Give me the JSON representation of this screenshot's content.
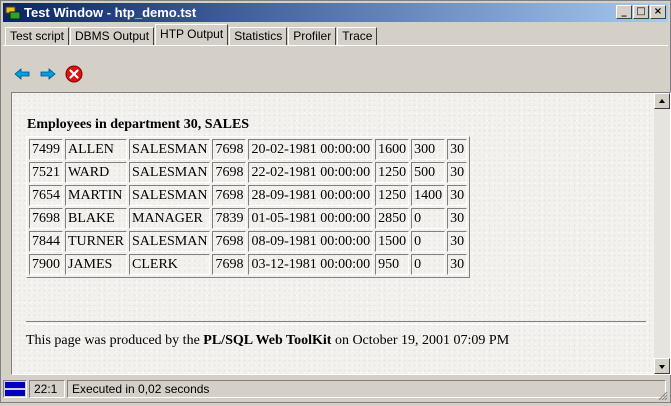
{
  "window": {
    "title": "Test Window - htp_demo.tst",
    "controls": {
      "minimize": "_",
      "maximize": "□",
      "close": "×"
    }
  },
  "tabs": [
    {
      "label": "Test script",
      "active": false
    },
    {
      "label": "DBMS Output",
      "active": false
    },
    {
      "label": "HTP Output",
      "active": true
    },
    {
      "label": "Statistics",
      "active": false
    },
    {
      "label": "Profiler",
      "active": false
    },
    {
      "label": "Trace",
      "active": false
    }
  ],
  "toolbar": {
    "buttons": [
      {
        "icon": "arrow-left-icon",
        "color": "#00a0e0"
      },
      {
        "icon": "arrow-right-icon",
        "color": "#00a0e0"
      },
      {
        "icon": "stop-icon",
        "color": "#e01010"
      }
    ]
  },
  "content": {
    "heading": "Employees in department 30, SALES",
    "rows": [
      [
        "7499",
        "ALLEN",
        "SALESMAN",
        "7698",
        "20-02-1981 00:00:00",
        "1600",
        "300",
        "30"
      ],
      [
        "7521",
        "WARD",
        "SALESMAN",
        "7698",
        "22-02-1981 00:00:00",
        "1250",
        "500",
        "30"
      ],
      [
        "7654",
        "MARTIN",
        "SALESMAN",
        "7698",
        "28-09-1981 00:00:00",
        "1250",
        "1400",
        "30"
      ],
      [
        "7698",
        "BLAKE",
        "MANAGER",
        "7839",
        "01-05-1981 00:00:00",
        "2850",
        "0",
        "30"
      ],
      [
        "7844",
        "TURNER",
        "SALESMAN",
        "7698",
        "08-09-1981 00:00:00",
        "1500",
        "0",
        "30"
      ],
      [
        "7900",
        "JAMES",
        "CLERK",
        "7698",
        "03-12-1981 00:00:00",
        "950",
        "0",
        "30"
      ]
    ],
    "footer": {
      "prefix": "This page was produced by the ",
      "bold": "PL/SQL Web ToolKit",
      "suffix": " on October 19, 2001 07:09 PM"
    }
  },
  "status": {
    "position": "22:1",
    "message": "Executed in 0,02 seconds"
  }
}
